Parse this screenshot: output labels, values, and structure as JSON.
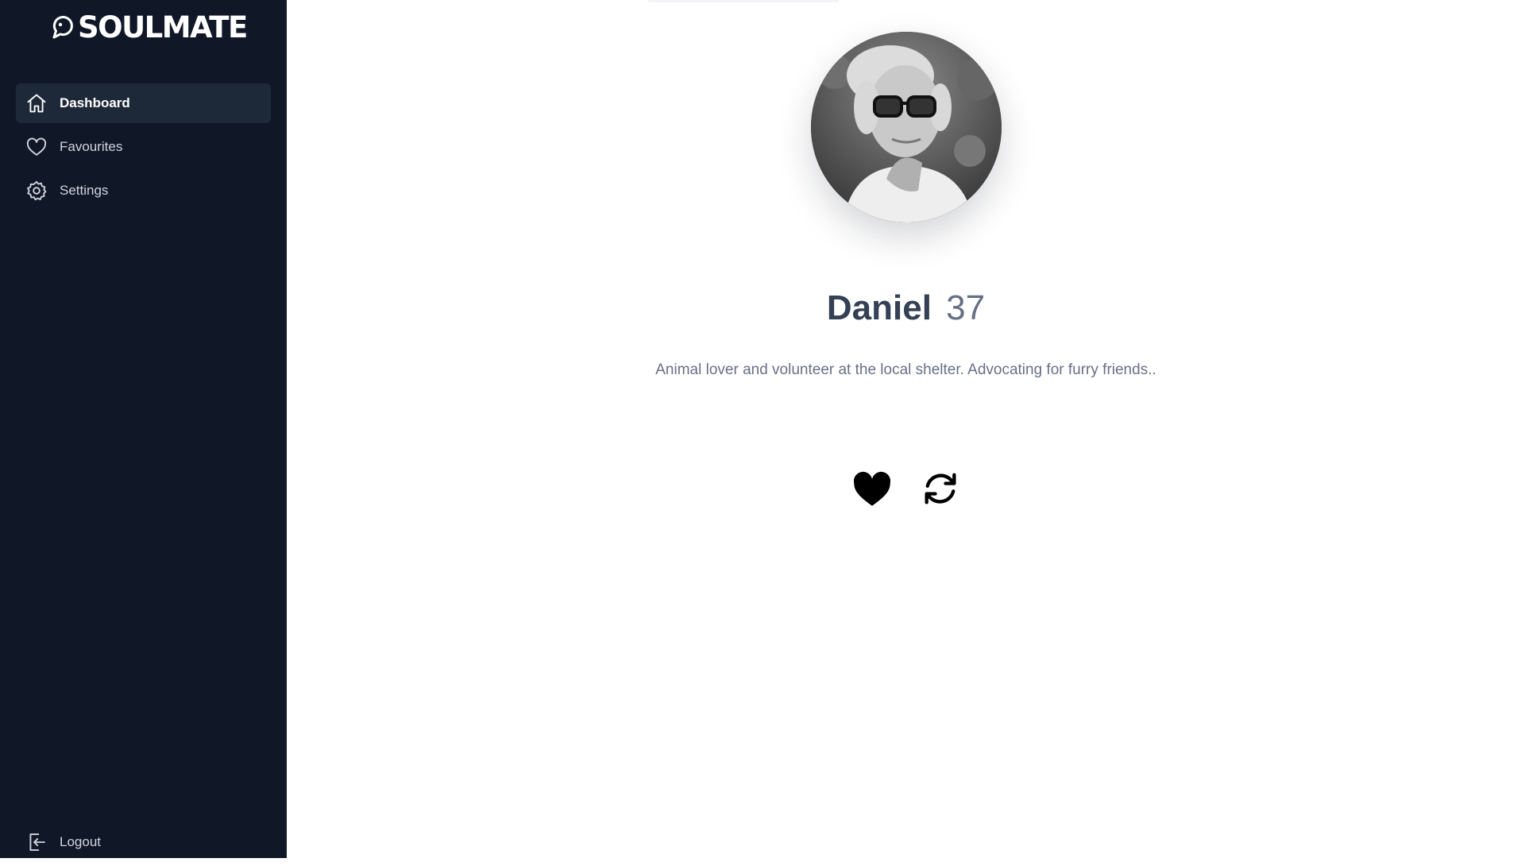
{
  "app": {
    "name": "SOULMATE"
  },
  "sidebar": {
    "items": [
      {
        "label": "Dashboard",
        "icon": "home-icon",
        "active": true
      },
      {
        "label": "Favourites",
        "icon": "heart-outline-icon",
        "active": false
      },
      {
        "label": "Settings",
        "icon": "gear-icon",
        "active": false
      }
    ],
    "logout": {
      "label": "Logout",
      "icon": "logout-icon"
    }
  },
  "profile": {
    "name": "Daniel",
    "age": "37",
    "bio": "Animal lover and volunteer at the local shelter. Advocating for furry friends..",
    "photo": "black-and-white portrait of older man with glasses"
  },
  "actions": [
    {
      "icon": "heart-filled-icon"
    },
    {
      "icon": "refresh-icon"
    }
  ],
  "colors": {
    "sidebar_bg": "#101828",
    "sidebar_active_bg": "#1d2939",
    "name_text": "#344054",
    "muted_text": "#667085"
  }
}
